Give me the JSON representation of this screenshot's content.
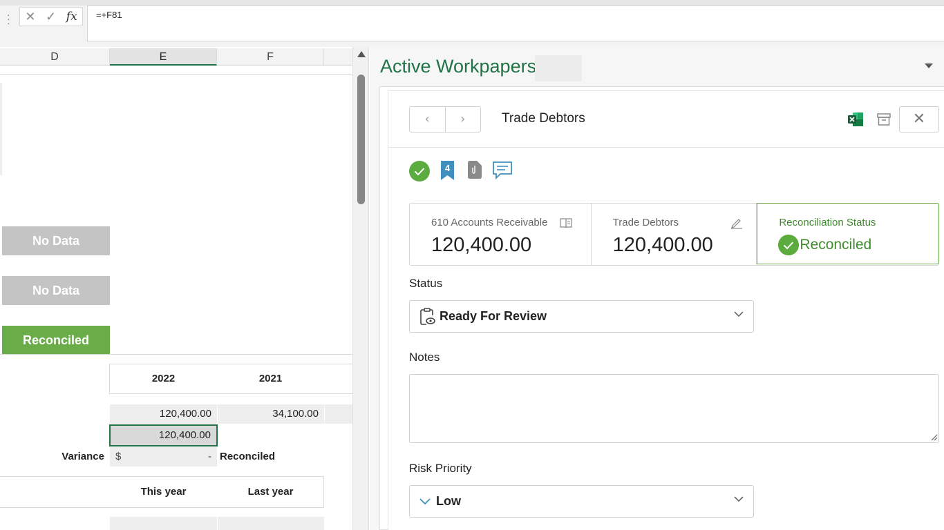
{
  "formula_bar": {
    "formula": "=+F81",
    "fx_label": "fx"
  },
  "sheet": {
    "columns": [
      "D",
      "E",
      "F"
    ],
    "status_blocks": [
      "No Data",
      "No Data",
      "Reconciled"
    ],
    "year_headers": [
      "2022",
      "2021"
    ],
    "values_row": [
      "120,400.00",
      "34,100.00"
    ],
    "selected_value": "120,400.00",
    "variance_label": "Variance",
    "variance_currency": "$",
    "variance_value": "-",
    "variance_status": "Reconciled",
    "period_headers": [
      "This year",
      "Last year"
    ]
  },
  "panel": {
    "title": "Active Workpapers",
    "card_title": "Trade Debtors",
    "bookmark_count": "4",
    "summary": {
      "account_label": "610 Accounts Receivable",
      "account_value": "120,400.00",
      "workpaper_label": "Trade Debtors",
      "workpaper_value": "120,400.00",
      "recon_label": "Reconciliation Status",
      "recon_value": "Reconciled"
    },
    "status_label": "Status",
    "status_value": "Ready For Review",
    "notes_label": "Notes",
    "notes_value": "",
    "risk_label": "Risk Priority",
    "risk_value": "Low"
  },
  "colors": {
    "excel_green": "#217346",
    "reconciled_green": "#6aac48",
    "no_data_grey": "#c4c4c4"
  }
}
